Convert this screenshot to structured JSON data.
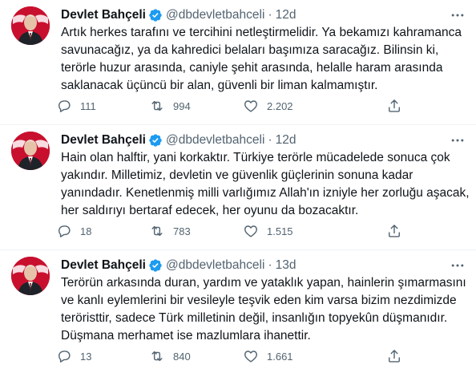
{
  "accent": "#1d9bf0",
  "muted_color": "#536471",
  "tweets": [
    {
      "author": "Devlet Bahçeli",
      "handle": "@dbdevletbahceli",
      "separator": "·",
      "time": "12d",
      "text": "Artık herkes tarafını ve tercihini netleştirmelidir. Ya bekamızı kahramanca savunacağız, ya da kahredici belaları başımıza saracağız. Bilinsin ki, terörle huzur arasında, caniyle şehit arasında, helalle haram arasında saklanacak üçüncü bir alan, güvenli bir liman kalmamıştır.",
      "replies": "111",
      "retweets": "994",
      "likes": "2.202"
    },
    {
      "author": "Devlet Bahçeli",
      "handle": "@dbdevletbahceli",
      "separator": "·",
      "time": "12d",
      "text": "Hain olan halftir, yani korkaktır. Türkiye terörle mücadelede sonuca çok yakındır. Milletimiz, devletin ve güvenlik güçlerinin sonuna kadar yanındadır. Kenetlenmiş milli varlığımız Allah'ın izniyle her zorluğu aşacak, her saldırıyı bertaraf edecek, her oyunu da bozacaktır.",
      "replies": "18",
      "retweets": "783",
      "likes": "1.515"
    },
    {
      "author": "Devlet Bahçeli",
      "handle": "@dbdevletbahceli",
      "separator": "·",
      "time": "13d",
      "text": "Terörün arkasında duran, yardım ve yataklık yapan, hainlerin şımarmasını ve kanlı eylemlerini bir vesileyle teşvik eden kim varsa bizim nezdimizde teröristtir, sadece Türk milletinin değil, insanlığın topyekûn düşmanıdır. Düşmana merhamet ise mazlumlara ihanettir.",
      "replies": "13",
      "retweets": "840",
      "likes": "1.661"
    }
  ]
}
